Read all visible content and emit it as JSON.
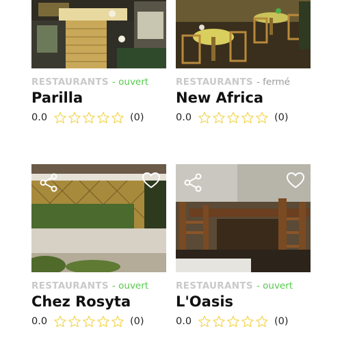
{
  "colors": {
    "open": "#56c94d",
    "closed": "#9a9a9a",
    "star_outline": "#f2d44a",
    "category": "#c9c9c9"
  },
  "cards": [
    {
      "category": "RESTAURANTS",
      "status": "- ouvert",
      "status_kind": "open",
      "name": "Parilla",
      "score": "0.0",
      "stars_filled": 0,
      "stars_total": 5,
      "reviews": "(0)",
      "photo_icon": "storefront-photo"
    },
    {
      "category": "RESTAURANTS",
      "status": "- fermé",
      "status_kind": "closed",
      "name": "New Africa",
      "score": "0.0",
      "stars_filled": 0,
      "stars_total": 5,
      "reviews": "(0)",
      "photo_icon": "dining-room-photo"
    },
    {
      "category": "RESTAURANTS",
      "status": "- ouvert",
      "status_kind": "open",
      "name": "Chez Rosyta",
      "score": "0.0",
      "stars_filled": 0,
      "stars_total": 5,
      "reviews": "(0)",
      "photo_icon": "terrace-photo"
    },
    {
      "category": "RESTAURANTS",
      "status": "- ouvert",
      "status_kind": "open",
      "name": "L'Oasis",
      "score": "0.0",
      "stars_filled": 0,
      "stars_total": 5,
      "reviews": "(0)",
      "photo_icon": "wooden-chairs-photo"
    }
  ],
  "icons": {
    "share": "share-icon",
    "favorite": "heart-icon",
    "star": "star-outline-icon"
  }
}
